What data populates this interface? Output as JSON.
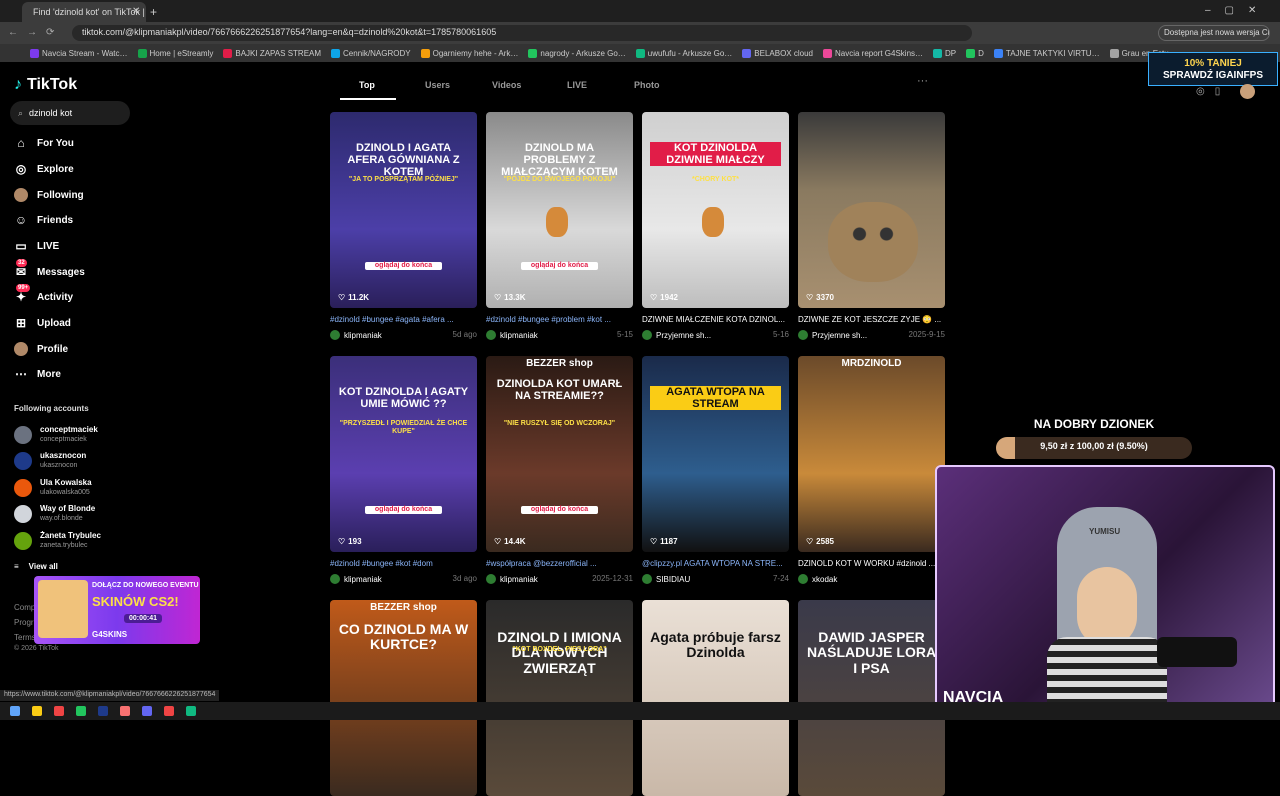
{
  "browser": {
    "tab_title": "Find 'dzinold kot' on TikTok | TikTok",
    "url": "tiktok.com/@klipmaniakpl/video/7667666226251877654?lang=en&q=dzinold%20kot&t=1785780061605",
    "update_notice": "Dostępna jest nowa wersja Chrome",
    "bookmarks": [
      "Navcia Stream - Watc…",
      "Home | eStreamly",
      "BAJKI ZAPAS STREAM",
      "Cennik/NAGRODY",
      "Ogarniemy hehe - Ark…",
      "nagrody - Arkusze Go…",
      "uwufufu - Arkusze Go…",
      "BELABOX cloud",
      "Navcia report G4Skins…",
      "DP",
      "D",
      "TAJNE TAKTYKI VIRTU…",
      "Grau en Estu…"
    ],
    "status_url": "https://www.tiktok.com/@klipmaniakpl/video/7667666226251877654"
  },
  "sidebar": {
    "logo": "TikTok",
    "search_value": "dzinold kot",
    "nav": [
      {
        "label": "For You",
        "icon": "home-icon"
      },
      {
        "label": "Explore",
        "icon": "compass-icon"
      },
      {
        "label": "Following",
        "icon": "following-avatar-icon"
      },
      {
        "label": "Friends",
        "icon": "friends-icon"
      },
      {
        "label": "LIVE",
        "icon": "live-icon"
      },
      {
        "label": "Messages",
        "icon": "messages-icon",
        "badge": "32"
      },
      {
        "label": "Activity",
        "icon": "activity-icon",
        "badge": "99+"
      },
      {
        "label": "Upload",
        "icon": "upload-icon"
      },
      {
        "label": "Profile",
        "icon": "profile-avatar-icon"
      },
      {
        "label": "More",
        "icon": "more-icon"
      }
    ],
    "following_title": "Following accounts",
    "accounts": [
      {
        "name": "conceptmaciek",
        "handle": "conceptmaciek"
      },
      {
        "name": "ukasznocon",
        "handle": "ukasznocon"
      },
      {
        "name": "Ula Kowalska",
        "handle": "ulakowalska005"
      },
      {
        "name": "Way of Blonde",
        "handle": "way.of.blonde"
      },
      {
        "name": "Żaneta Trybulec",
        "handle": "zaneta.trybulec"
      }
    ],
    "view_all": "View all",
    "footer_items": [
      "Comp",
      "Progr",
      "Terms"
    ],
    "copyright": "© 2026 TikTok"
  },
  "promo": {
    "line1": "DOŁĄCZ DO NOWEGO EVENTU",
    "line2": "SKINÓW CS2!",
    "timer": "00:00:41",
    "brand": "G4SKINS"
  },
  "tabs": [
    "Top",
    "Users",
    "Videos",
    "LIVE",
    "Photo"
  ],
  "videos": [
    {
      "caption": "DZINOLD I AGATA AFERA GÓWNIANA Z KOTEM",
      "sub": "\"JA TO POSPRZĄTAM PÓŹNIEJ\"",
      "bottom": "oglądaj do końca",
      "likes": "11.2K",
      "desc": "#dzinold #bungee #agata #afera ...",
      "author": "klipmaniak",
      "date": "5d ago"
    },
    {
      "caption": "DZINOLD MA PROBLEMY Z MIAŁCZĄCYM KOTEM",
      "sub": "\"PÓJDŹ DO SWOJEGO POKOJU\"",
      "bottom": "oglądaj do końca",
      "likes": "13.3K",
      "desc": "#dzinold #bungee #problem #kot ...",
      "author": "klipmaniak",
      "date": "5-15"
    },
    {
      "caption": "KOT DZINOLDA DZIWNIE MIAŁCZY",
      "sub": "*CHORY KOT*",
      "bottom": "",
      "likes": "1942",
      "desc": "DZIWNE MIAŁCZENIE KOTA DZINOL...",
      "author": "Przyjemne sh...",
      "date": "5-16"
    },
    {
      "caption": "",
      "sub": "",
      "bottom": "",
      "likes": "3370",
      "desc": "DZIWNE ZE KOT JESZCZE ZYJE 😳 ...",
      "author": "Przyjemne sh...",
      "date": "2025-9-15"
    },
    {
      "caption": "KOT DZINOLDA I AGATY UMIE MÓWIĆ ??",
      "sub": "\"PRZYSZEDŁ I POWIEDZIAŁ ŻE CHCE KUPE\"",
      "bottom": "oglądaj do końca",
      "likes": "193",
      "desc": "#dzinold #bungee #kot #dom",
      "author": "klipmaniak",
      "date": "3d ago"
    },
    {
      "caption": "DZINOLDA KOT UMARŁ NA STREAMIE??",
      "sub": "\"NIE RUSZYŁ SIĘ OD WCZORAJ\"",
      "bottom": "oglądaj do końca",
      "likes": "14.4K",
      "desc": "#współpraca @bezzerofficial ...",
      "author": "klipmaniak",
      "date": "2025-12-31",
      "top": "BEZZER shop"
    },
    {
      "caption": "AGATA WTOPA NA STREAM",
      "sub": "",
      "bottom": "",
      "likes": "1187",
      "desc": "@clipzzy.pl AGATA WTOPA NA STRE...",
      "author": "SIBIDIAU",
      "date": "7-24"
    },
    {
      "caption": "",
      "sub": "",
      "bottom": "",
      "likes": "2585",
      "desc": "DZINOLD KOT W WORKU #dzinold ...",
      "author": "xkodak",
      "date": "",
      "top": "MRDZINOLD"
    },
    {
      "caption": "CO DZINOLD MA W KURTCE?",
      "sub": "",
      "bottom": "",
      "likes": "",
      "desc": "",
      "author": "",
      "date": "",
      "top": "BEZZER shop"
    },
    {
      "caption": "DZINOLD I IMIONA DLA NOWYCH ZWIERZĄT",
      "sub": "\"KOT BOXDEL, PIES LORA\"",
      "bottom": "",
      "likes": "",
      "desc": "",
      "author": "",
      "date": ""
    },
    {
      "caption": "Agata próbuje farsz Dzinolda",
      "sub": "",
      "bottom": "",
      "likes": "",
      "desc": "",
      "author": "",
      "date": ""
    },
    {
      "caption": "DAWID JASPER NAŚLADUJE LORA I PSA",
      "sub": "",
      "bottom": "",
      "likes": "",
      "desc": "",
      "author": "",
      "date": ""
    }
  ],
  "ad": {
    "line1": "10% TANIEJ",
    "line2": "SPRAWDŹ IGAINFPS"
  },
  "goal": {
    "title": "NA DOBRY DZIONEK",
    "text": "9,50 zł z 100,00 zł (9.50%)",
    "progress": 0.095
  },
  "webcam": {
    "label": "NAVCIA",
    "chair_text": "YUMISU"
  },
  "colors": {
    "accent": "#fe2c55",
    "link": "#8ab4f8",
    "goal_fill": "#d6a77a"
  }
}
